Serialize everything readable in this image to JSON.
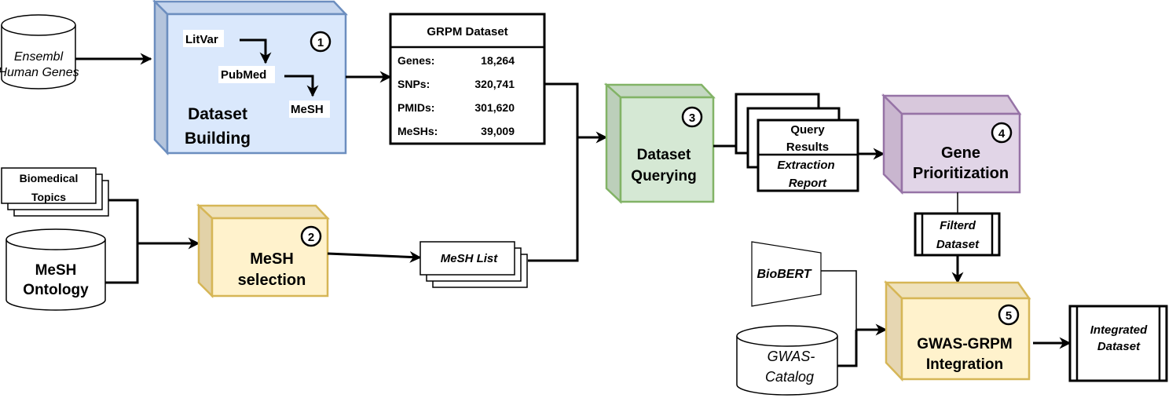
{
  "colors": {
    "building": "#dae8fc",
    "building_stroke": "#6c8ebf",
    "selection": "#fff2cc",
    "selection_stroke": "#d6b656",
    "querying": "#d5e8d4",
    "querying_stroke": "#82b366",
    "prioritization": "#e1d5e7",
    "prioritization_stroke": "#9673a6",
    "integration": "#fff2cc",
    "integration_stroke": "#d6b656"
  },
  "inputs": {
    "ensembl": [
      "Ensembl",
      "Human Genes"
    ],
    "biomedical_topics": [
      "Biomedical",
      "Topics"
    ],
    "mesh_ontology": [
      "MeSH",
      "Ontology"
    ],
    "biobert": "BioBERT",
    "gwas_catalog": [
      "GWAS-",
      "Catalog"
    ]
  },
  "steps": [
    {
      "number": "1",
      "title": [
        "Dataset",
        "Building"
      ],
      "sub": [
        "LitVar",
        "PubMed",
        "MeSH"
      ]
    },
    {
      "number": "2",
      "title": [
        "MeSH",
        "selection"
      ]
    },
    {
      "number": "3",
      "title": [
        "Dataset",
        "Querying"
      ]
    },
    {
      "number": "4",
      "title": [
        "Gene",
        "Prioritization"
      ]
    },
    {
      "number": "5",
      "title": [
        "GWAS-GRPM",
        "Integration"
      ]
    }
  ],
  "grpm_table": {
    "title": "GRPM Dataset",
    "rows": [
      {
        "label": "Genes:",
        "value": "18,264"
      },
      {
        "label": "SNPs:",
        "value": "320,741"
      },
      {
        "label": "PMIDs:",
        "value": "301,620"
      },
      {
        "label": "MeSHs:",
        "value": "39,009"
      }
    ]
  },
  "outputs": {
    "mesh_list": "MeSH List",
    "query_results": [
      "Query",
      "Results"
    ],
    "extraction_report": [
      "Extraction",
      "Report"
    ],
    "filtered_dataset": [
      "Filterd",
      "Dataset"
    ],
    "integrated_dataset": [
      "Integrated",
      "Dataset"
    ]
  }
}
